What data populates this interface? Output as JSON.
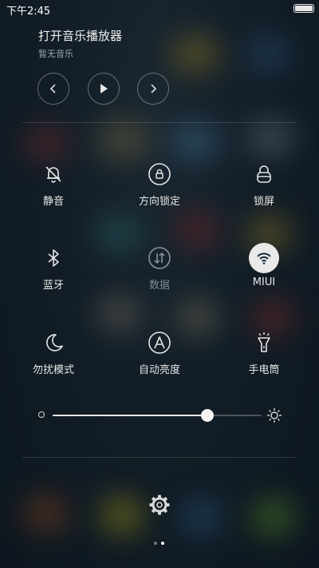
{
  "status_bar": {
    "time": "下午2:45"
  },
  "music": {
    "title": "打开音乐播放器",
    "subtitle": "暂无音乐",
    "controls": {
      "prev_icon": "chevron-left-icon",
      "play_icon": "play-icon",
      "next_icon": "chevron-right-icon"
    }
  },
  "toggles": [
    {
      "label": "静音",
      "icon": "bell-off-icon",
      "state": "off"
    },
    {
      "label": "方向锁定",
      "icon": "rotation-lock-icon",
      "state": "off"
    },
    {
      "label": "锁屏",
      "icon": "lock-icon",
      "state": "off"
    },
    {
      "label": "蓝牙",
      "icon": "bluetooth-icon",
      "state": "off"
    },
    {
      "label": "数据",
      "icon": "mobile-data-icon",
      "state": "disabled"
    },
    {
      "label": "MIUI",
      "icon": "wifi-icon",
      "state": "on"
    },
    {
      "label": "勿扰模式",
      "icon": "moon-icon",
      "state": "off"
    },
    {
      "label": "自动亮度",
      "icon": "auto-brightness-icon",
      "state": "off"
    },
    {
      "label": "手电筒",
      "icon": "flashlight-icon",
      "state": "off"
    }
  ],
  "brightness": {
    "level": 0.74
  },
  "settings": {
    "icon": "gear-icon"
  },
  "pager": {
    "count": 2,
    "active": 1
  },
  "colors": {
    "active_toggle_bg": "#e9e9e9",
    "active_toggle_icon": "#1c2a34",
    "text": "#e6e6e6",
    "disabled_text": "#7f8a93"
  }
}
